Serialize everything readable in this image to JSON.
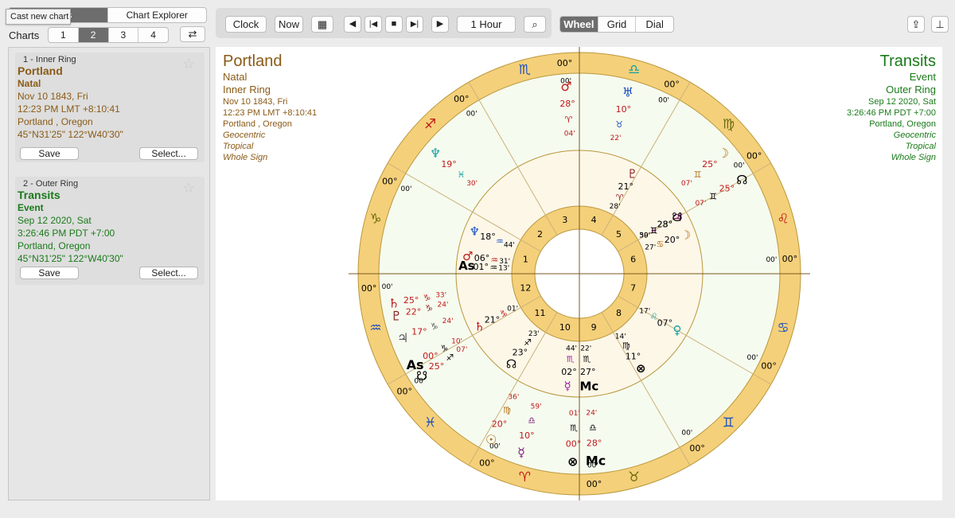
{
  "tooltip": "Cast new chart",
  "top_tabs": [
    "Charts",
    "Chart Explorer"
  ],
  "charts_label": "Charts",
  "chart_numbers": [
    "1",
    "2",
    "3",
    "4"
  ],
  "toolbar": {
    "clock": "Clock",
    "now": "Now",
    "interval": "1 Hour",
    "views": [
      "Wheel",
      "Grid",
      "Dial"
    ]
  },
  "cards": [
    {
      "header": "1 - Inner Ring",
      "name": "Portland",
      "type": "Natal",
      "date": "Nov 10 1843, Fri",
      "time": "12:23 PM LMT +8:10:41",
      "place": "Portland , Oregon",
      "coords": "45°N31'25\" 122°W40'30\"",
      "save": "Save",
      "select": "Select..."
    },
    {
      "header": "2 - Outer Ring",
      "name": "Transits",
      "type": "Event",
      "date": "Sep 12 2020, Sat",
      "time": "3:26:46 PM PDT +7:00",
      "place": "Portland, Oregon",
      "coords": "45°N31'25\" 122°W40'30\"",
      "save": "Save",
      "select": "Select..."
    }
  ],
  "left_info": {
    "title": "Portland",
    "type": "Natal",
    "ring": "Inner Ring",
    "date": "Nov 10 1843, Fri",
    "time": "12:23 PM LMT +8:10:41",
    "place": "Portland , Oregon",
    "geo": "Geocentric",
    "zodiac": "Tropical",
    "houses": "Whole Sign"
  },
  "right_info": {
    "title": "Transits",
    "type": "Event",
    "ring": "Outer Ring",
    "date": "Sep 12 2020, Sat",
    "time": "3:26:46 PM PDT +7:00",
    "place": "Portland, Oregon",
    "geo": "Geocentric",
    "zodiac": "Tropical",
    "houses": "Whole Sign"
  },
  "colors": {
    "natal_text": "#8a5a16",
    "transit_text": "#1a7a1a",
    "rim": "#f5d07a",
    "wheel_bg": "#f6fbef"
  },
  "signs": [
    "♒",
    "♓",
    "♈",
    "♉",
    "♊",
    "♋",
    "♌",
    "♍",
    "♎",
    "♏",
    "♐",
    "♑"
  ],
  "sign_colors": [
    "#1a4fc0",
    "#1a4fc0",
    "#c01818",
    "#6a6a10",
    "#1a4fc0",
    "#1a4fc0",
    "#c01818",
    "#6a6a10",
    "#18a0a0",
    "#1a4fc0",
    "#c01818",
    "#6a6a10"
  ],
  "rim_degree": "00°",
  "rim_minute": "00'",
  "houses": [
    "1",
    "2",
    "3",
    "4",
    "5",
    "6",
    "7",
    "8",
    "9",
    "10",
    "11",
    "12"
  ],
  "inner_glyphs": [
    {
      "g": "As",
      "deg": "01°",
      "min": "13'",
      "sign": "♒",
      "color": "#000"
    },
    {
      "g": "♂",
      "deg": "06°",
      "min": "31'",
      "sign": "♒",
      "color": "#c01818"
    },
    {
      "g": "♆",
      "deg": "18°",
      "min": "44'",
      "sign": "♒",
      "color": "#1a4fc0"
    },
    {
      "g": "♄",
      "deg": "21°",
      "min": "01'",
      "sign": "♑",
      "color": "#c01818"
    },
    {
      "g": "☊",
      "deg": "23°",
      "min": "23'",
      "sign": "♐",
      "color": "#000"
    },
    {
      "g": "☿",
      "deg": "02°",
      "min": "44'",
      "sign": "♏",
      "color": "#9b1fa8"
    },
    {
      "g": "Mc",
      "deg": "27°",
      "min": "22'",
      "sign": "♏",
      "color": "#000"
    },
    {
      "g": "♃",
      "deg": "28°",
      "min": "39'",
      "sign": "♓",
      "color": "#7a1a7a"
    },
    {
      "g": "♇",
      "deg": "21°",
      "min": "28'",
      "sign": "♈",
      "color": "#8a1a1a"
    },
    {
      "g": "⊗",
      "deg": "11°",
      "min": "14'",
      "sign": "♍",
      "color": "#000"
    },
    {
      "g": "♀",
      "deg": "07°",
      "min": "17'",
      "sign": "♌",
      "color": "#18a0a0"
    },
    {
      "g": "☽",
      "deg": "20°",
      "min": "27'",
      "sign": "♋",
      "color": "#b06b10"
    },
    {
      "g": "☋",
      "deg": "23°",
      "min": "50'",
      "sign": "♊",
      "color": "#000"
    }
  ],
  "outer_glyphs": [
    {
      "g": "⊗",
      "deg": "00°",
      "min": "01'",
      "sign": "♏",
      "color": "#000"
    },
    {
      "g": "Mc",
      "deg": "28°",
      "min": "24'",
      "sign": "♎",
      "color": "#000"
    },
    {
      "g": "☿",
      "deg": "10°",
      "min": "59'",
      "sign": "♎",
      "color": "#7a1a7a"
    },
    {
      "g": "☉",
      "deg": "20°",
      "min": "36'",
      "sign": "♍",
      "color": "#b06b10"
    },
    {
      "g": "☊",
      "deg": "25°",
      "min": "07'",
      "sign": "♊",
      "color": "#000"
    },
    {
      "g": "♇",
      "deg": "22°",
      "min": "24'",
      "sign": "♑",
      "color": "#8a1a1a"
    },
    {
      "g": "♄",
      "deg": "25°",
      "min": "33'",
      "sign": "♑",
      "color": "#c01818"
    },
    {
      "g": "♃",
      "deg": "17°",
      "min": "24'",
      "sign": "♑",
      "color": "#555"
    },
    {
      "g": "☋",
      "deg": "25°",
      "min": "07'",
      "sign": "♐",
      "color": "#000"
    },
    {
      "g": "As",
      "deg": "00°",
      "min": "10'",
      "sign": "♑",
      "color": "#000"
    },
    {
      "g": "♆",
      "deg": "19°",
      "min": "30'",
      "sign": "♓",
      "color": "#18a0a0"
    },
    {
      "g": "♂",
      "deg": "28°",
      "min": "04'",
      "sign": "♈",
      "color": "#c01818"
    },
    {
      "g": "♅",
      "deg": "10°",
      "min": "22'",
      "sign": "♉",
      "color": "#1a4fc0"
    },
    {
      "g": "☽",
      "deg": "25°",
      "min": "07'",
      "sign": "♊",
      "color": "#b06b10"
    }
  ]
}
